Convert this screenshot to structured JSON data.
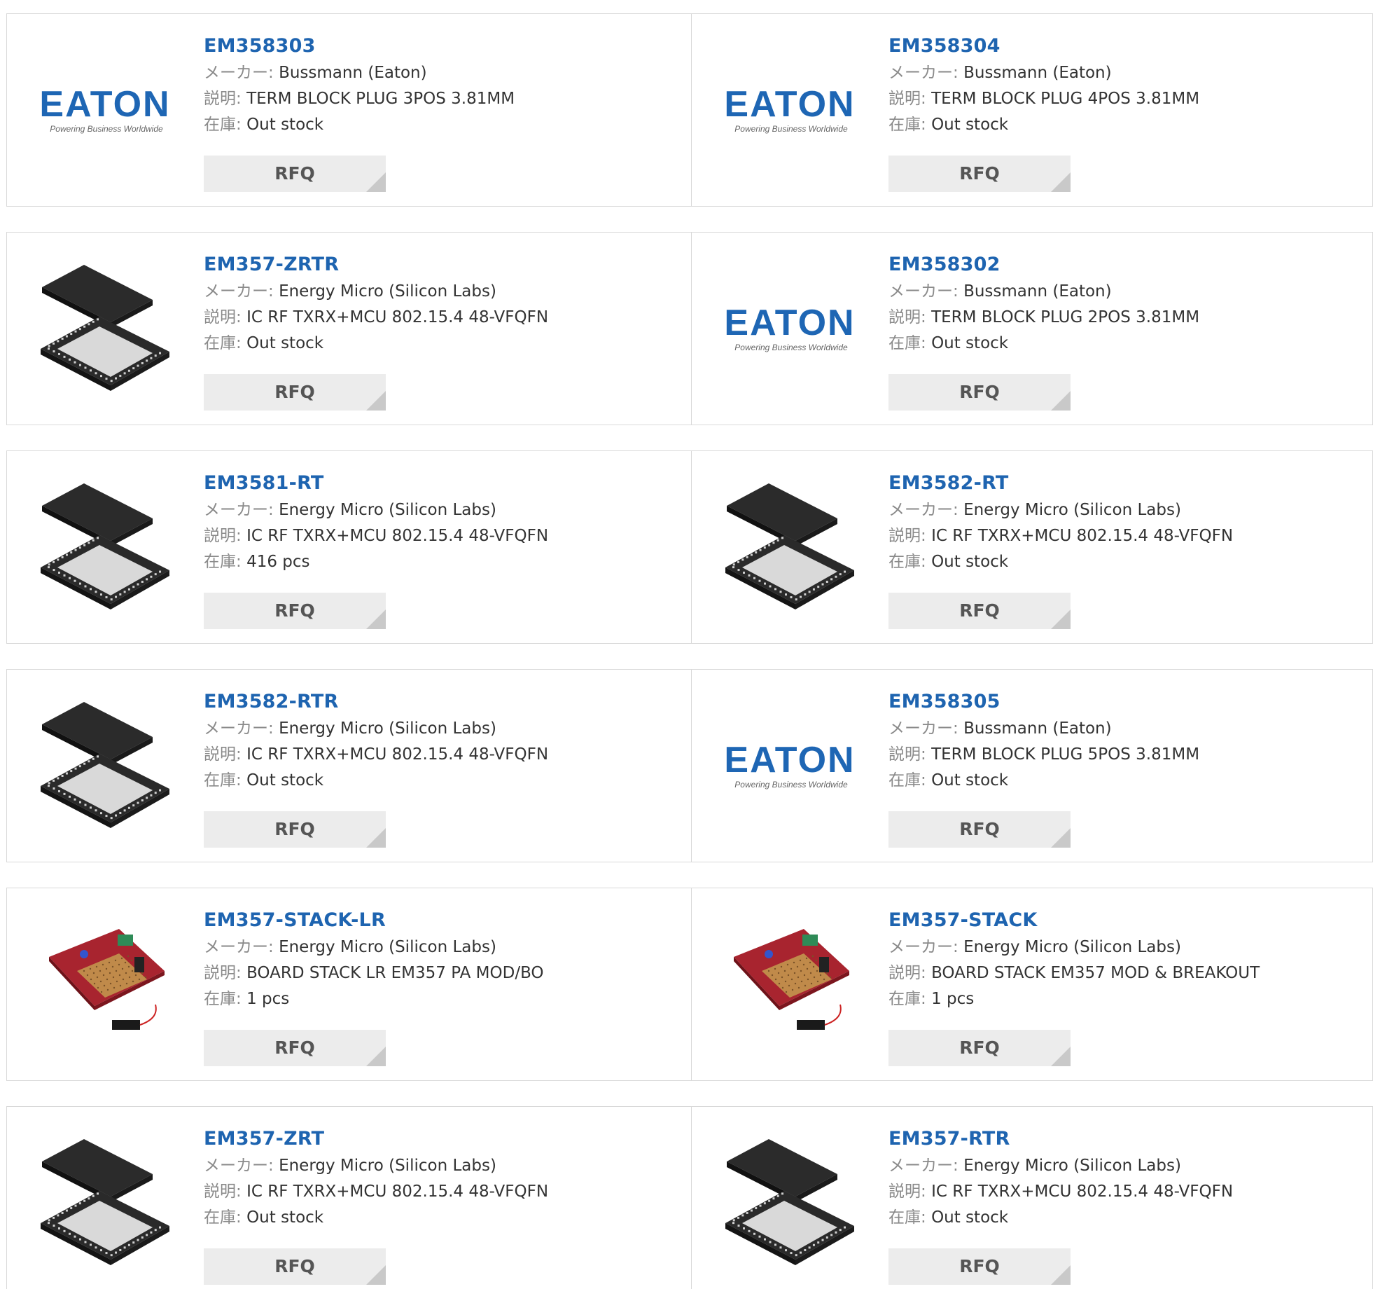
{
  "colors": {
    "part_link": "#1e64b0",
    "eaton_blue": "#1e66b4",
    "border": "#d9d9d9",
    "rfq_bg": "#ececec"
  },
  "labels": {
    "maker": "メーカー:",
    "description": "説明:",
    "stock": "在庫:"
  },
  "eaton_logo": {
    "wordmark": "EATON",
    "tagline": "Powering Business Worldwide"
  },
  "products": [
    {
      "part": "EM358303",
      "maker": "Bussmann (Eaton)",
      "description": "TERM BLOCK PLUG 3POS 3.81MM",
      "stock": "Out stock",
      "image": "eaton-logo",
      "button": "RFQ"
    },
    {
      "part": "EM358304",
      "maker": "Bussmann (Eaton)",
      "description": "TERM BLOCK PLUG 4POS 3.81MM",
      "stock": "Out stock",
      "image": "eaton-logo",
      "button": "RFQ"
    },
    {
      "part": "EM357-ZRTR",
      "maker": "Energy Micro (Silicon Labs)",
      "description": "IC RF TXRX+MCU 802.15.4 48-VFQFN",
      "stock": "Out stock",
      "image": "chip-package",
      "button": "RFQ"
    },
    {
      "part": "EM358302",
      "maker": "Bussmann (Eaton)",
      "description": "TERM BLOCK PLUG 2POS 3.81MM",
      "stock": "Out stock",
      "image": "eaton-logo",
      "button": "RFQ"
    },
    {
      "part": "EM3581-RT",
      "maker": "Energy Micro (Silicon Labs)",
      "description": "IC RF TXRX+MCU 802.15.4 48-VFQFN",
      "stock": "416 pcs",
      "image": "chip-package",
      "button": "RFQ"
    },
    {
      "part": "EM3582-RT",
      "maker": "Energy Micro (Silicon Labs)",
      "description": "IC RF TXRX+MCU 802.15.4 48-VFQFN",
      "stock": "Out stock",
      "image": "chip-package",
      "button": "RFQ"
    },
    {
      "part": "EM3582-RTR",
      "maker": "Energy Micro (Silicon Labs)",
      "description": "IC RF TXRX+MCU 802.15.4 48-VFQFN",
      "stock": "Out stock",
      "image": "chip-package",
      "button": "RFQ"
    },
    {
      "part": "EM358305",
      "maker": "Bussmann (Eaton)",
      "description": "TERM BLOCK PLUG 5POS 3.81MM",
      "stock": "Out stock",
      "image": "eaton-logo",
      "button": "RFQ"
    },
    {
      "part": "EM357-STACK-LR",
      "maker": "Energy Micro (Silicon Labs)",
      "description": "BOARD STACK LR EM357 PA MOD/BO",
      "stock": "1 pcs",
      "image": "dev-board",
      "button": "RFQ"
    },
    {
      "part": "EM357-STACK",
      "maker": "Energy Micro (Silicon Labs)",
      "description": "BOARD STACK EM357 MOD & BREAKOUT",
      "stock": "1 pcs",
      "image": "dev-board",
      "button": "RFQ"
    },
    {
      "part": "EM357-ZRT",
      "maker": "Energy Micro (Silicon Labs)",
      "description": "IC RF TXRX+MCU 802.15.4 48-VFQFN",
      "stock": "Out stock",
      "image": "chip-package",
      "button": "RFQ"
    },
    {
      "part": "EM357-RTR",
      "maker": "Energy Micro (Silicon Labs)",
      "description": "IC RF TXRX+MCU 802.15.4 48-VFQFN",
      "stock": "Out stock",
      "image": "chip-package",
      "button": "RFQ"
    }
  ]
}
